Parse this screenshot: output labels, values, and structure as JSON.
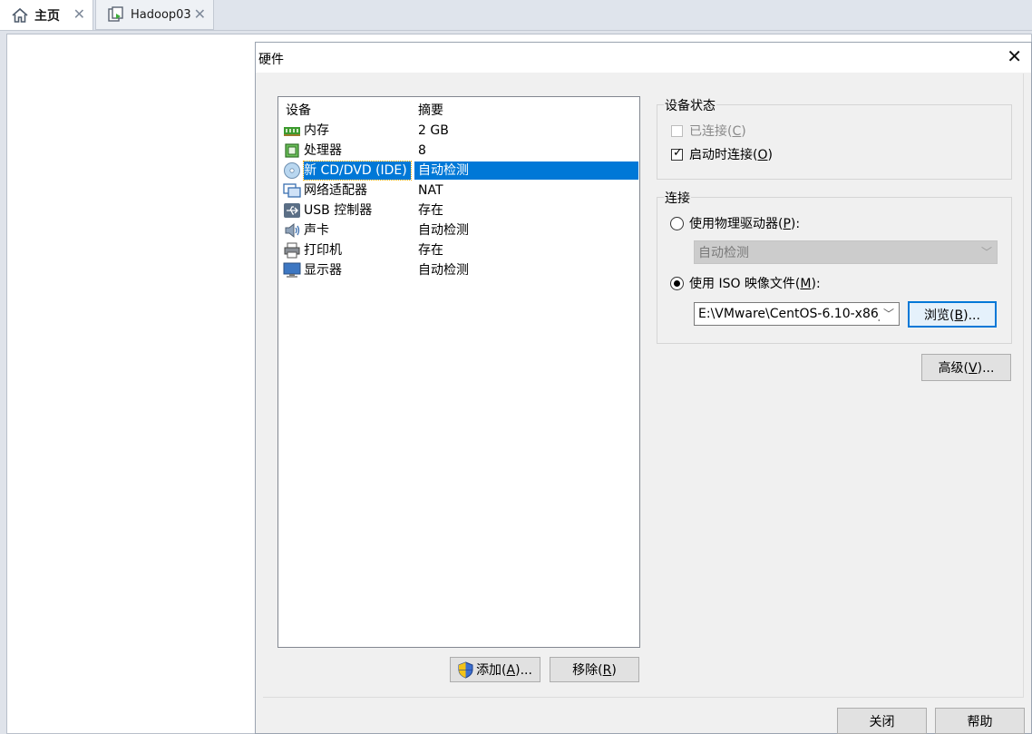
{
  "tabs": [
    {
      "label": "主页",
      "icon": "home-icon",
      "close": "✕"
    },
    {
      "label": "Hadoop03",
      "icon": "vm-icon",
      "close": "✕"
    }
  ],
  "dialog": {
    "title": "硬件",
    "close": "✕",
    "device_list": {
      "headers": {
        "device": "设备",
        "summary": "摘要"
      },
      "rows": [
        {
          "name": "内存",
          "summary": "2 GB",
          "icon": "memory-icon"
        },
        {
          "name": "处理器",
          "summary": "8",
          "icon": "processor-icon"
        },
        {
          "name": "新 CD/DVD (IDE)",
          "summary": "自动检测",
          "icon": "cd-dvd-icon",
          "selected": true
        },
        {
          "name": "网络适配器",
          "summary": "NAT",
          "icon": "network-adapter-icon"
        },
        {
          "name": "USB 控制器",
          "summary": "存在",
          "icon": "usb-icon"
        },
        {
          "name": "声卡",
          "summary": "自动检测",
          "icon": "sound-card-icon"
        },
        {
          "name": "打印机",
          "summary": "存在",
          "icon": "printer-icon"
        },
        {
          "name": "显示器",
          "summary": "自动检测",
          "icon": "display-icon"
        }
      ]
    },
    "buttons": {
      "add": {
        "text": "添加(",
        "key": "A",
        "suffix": ")...",
        "icon": "shield-icon"
      },
      "remove": {
        "text": "移除(",
        "key": "R",
        "suffix": ")"
      },
      "browse": {
        "text": "浏览(",
        "key": "B",
        "suffix": ")..."
      },
      "advanced": {
        "text": "高级(",
        "key": "V",
        "suffix": ")..."
      },
      "close": "关闭",
      "help": "帮助"
    },
    "device_status": {
      "label": "设备状态",
      "connected": {
        "text": "已连接(",
        "key": "C",
        "suffix": ")",
        "checked": false,
        "enabled": false
      },
      "connect_at_power_on": {
        "text": "启动时连接(",
        "key": "O",
        "suffix": ")",
        "checked": true,
        "enabled": true
      }
    },
    "connection": {
      "label": "连接",
      "physical_drive": {
        "text": "使用物理驱动器(",
        "key": "P",
        "suffix": "):",
        "selected": false,
        "dropdown_value": "自动检测"
      },
      "iso_image": {
        "text": "使用 ISO 映像文件(",
        "key": "M",
        "suffix": "):",
        "selected": true,
        "path_value": "E:\\VMware\\CentOS-6.10-x86_"
      }
    }
  }
}
